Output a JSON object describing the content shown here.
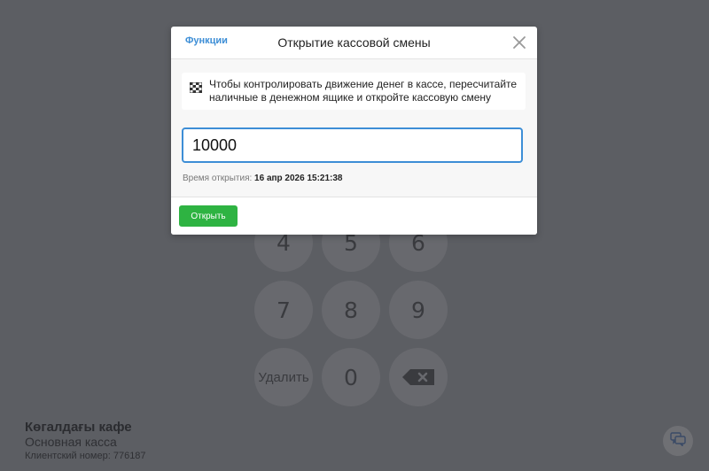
{
  "keypad": {
    "keys": [
      "4",
      "5",
      "6",
      "7",
      "8",
      "9",
      "Удалить",
      "0"
    ],
    "backspace_icon": "backspace-icon"
  },
  "company": {
    "name": "Көгалдағы кафе",
    "register": "Основная касса",
    "client_number": "Клиентский номер: 776187"
  },
  "modal": {
    "functions_label": "Функции",
    "title": "Открытие кассовой смены",
    "info_text": "Чтобы контролировать движение денег в кассе, пересчитайте наличные в денежном ящике и откройте кассовую смену",
    "amount_value": "10000",
    "open_time_label": "Время открытия:",
    "open_time_value": "16 апр 2026 15:21:38",
    "open_button_label": "Открыть"
  },
  "colors": {
    "accent": "#3d8ed6",
    "success": "#2eb342",
    "backdrop": "#5c5e63"
  }
}
